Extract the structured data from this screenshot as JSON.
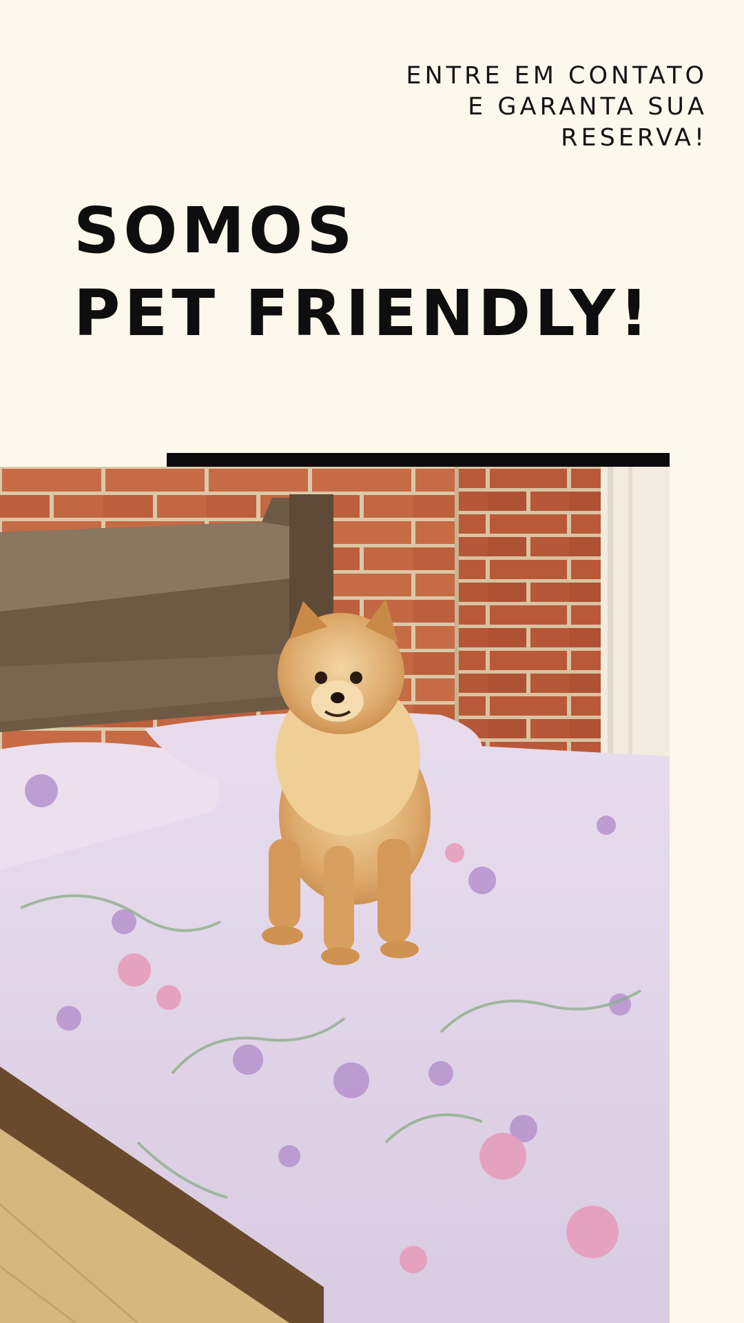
{
  "cta": {
    "line1": "ENTRE EM CONTATO",
    "line2": "E GARANTA SUA",
    "line3": "RESERVA!"
  },
  "headline": {
    "line1": "SOMOS",
    "line2": "PET FRIENDLY!"
  },
  "colors": {
    "background": "#fdf8ec",
    "text": "#111111",
    "accent_bar": "#0b0b0b"
  },
  "photo": {
    "subject": "pomeranian-dog-on-bed"
  }
}
